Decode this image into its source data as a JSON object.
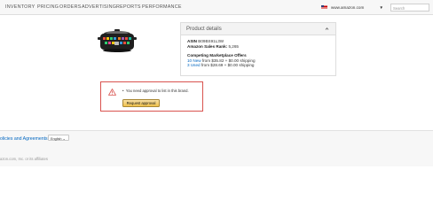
{
  "nav": {
    "items": [
      {
        "label": "INVENTORY"
      },
      {
        "label": "PRICING"
      },
      {
        "label": "ORDERS"
      },
      {
        "label": "ADVERTISING"
      },
      {
        "label": "REPORTS"
      },
      {
        "label": "PERFORMANCE"
      }
    ],
    "marketplace": "www.amazon.com",
    "search_placeholder": "Search"
  },
  "product": {
    "image_alt": "slow cooker"
  },
  "details": {
    "title": "Product details",
    "asin_label": "ASIN",
    "asin_value": "B09BS91L3W",
    "rank_label": "Amazon Sales Rank:",
    "rank_value": "5,265",
    "offers_heading": "Competing Marketplace Offers",
    "new_link": "10 New",
    "new_text": "from $35.82 + $0.00 shipping",
    "used_link": "3 Used",
    "used_text": "from $28.69 + $0.00 shipping"
  },
  "alert": {
    "message": "You need approval to list in this brand.",
    "button": "Request approval",
    "color": "#d9534f"
  },
  "footer": {
    "link": "olicies and Agreements",
    "language": "English",
    "copyright": "azon.com, Inc. or its affiliates"
  }
}
